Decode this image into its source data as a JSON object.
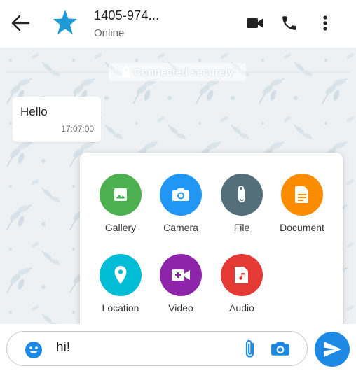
{
  "header": {
    "back_icon": "arrow-left-icon",
    "avatar_icon": "star-icon",
    "contact_name": "1405-974...",
    "status": "Online",
    "video_call_icon": "video-camera-icon",
    "voice_call_icon": "phone-icon",
    "more_icon": "more-vertical-icon"
  },
  "chat": {
    "secure_banner": "Connected securely",
    "messages": [
      {
        "text": "Hello",
        "time": "17:07:00"
      }
    ]
  },
  "attachments": [
    {
      "label": "Gallery",
      "icon": "image-icon",
      "color": "#4caf50"
    },
    {
      "label": "Camera",
      "icon": "camera-icon",
      "color": "#2196f3"
    },
    {
      "label": "File",
      "icon": "paperclip-icon",
      "color": "#546e7a"
    },
    {
      "label": "Document",
      "icon": "document-icon",
      "color": "#fb8c00"
    },
    {
      "label": "Location",
      "icon": "location-pin-icon",
      "color": "#00bcd4"
    },
    {
      "label": "Video",
      "icon": "video-add-icon",
      "color": "#8e24aa"
    },
    {
      "label": "Audio",
      "icon": "audio-file-icon",
      "color": "#e53935"
    }
  ],
  "composer": {
    "emoji_icon": "emoji-icon",
    "input_value": "hi!",
    "attach_icon": "paperclip-icon",
    "camera_icon": "camera-icon",
    "send_icon": "send-icon"
  },
  "colors": {
    "accent": "#1e88e5",
    "header_icon": "#222222",
    "input_icons": "#1e88e5"
  }
}
